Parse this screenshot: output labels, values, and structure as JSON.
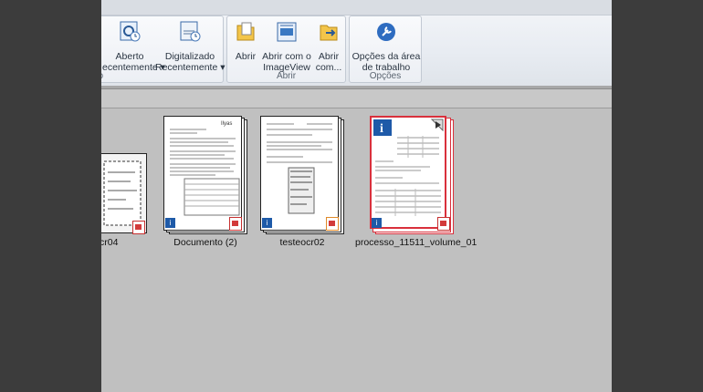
{
  "ribbon": {
    "groups": [
      {
        "label": "ho"
      },
      {
        "label": "Abrir"
      },
      {
        "label": "Opções"
      }
    ],
    "buttons": {
      "aberto": {
        "line1": "Aberto",
        "line2": "ecentemente ▾"
      },
      "digitalizado": {
        "line1": "Digitalizado",
        "line2": "Recentemente ▾"
      },
      "abrir": {
        "line1": "Abrir"
      },
      "abrir_imageview": {
        "line1": "Abrir com o",
        "line2": "ImageView"
      },
      "abrir_com": {
        "line1": "Abrir",
        "line2": "com..."
      },
      "opcoes_area": {
        "line1": "Opções da área",
        "line2": "de trabalho"
      }
    }
  },
  "documents": [
    {
      "name": "cr04"
    },
    {
      "name": "Documento (2)"
    },
    {
      "name": "testeocr02"
    },
    {
      "name": "processo_11511_volume_01"
    }
  ],
  "colors": {
    "selected_border": "#d9303c",
    "badge": "#1e5aa8",
    "pdf_icon": "#d23a3a"
  }
}
